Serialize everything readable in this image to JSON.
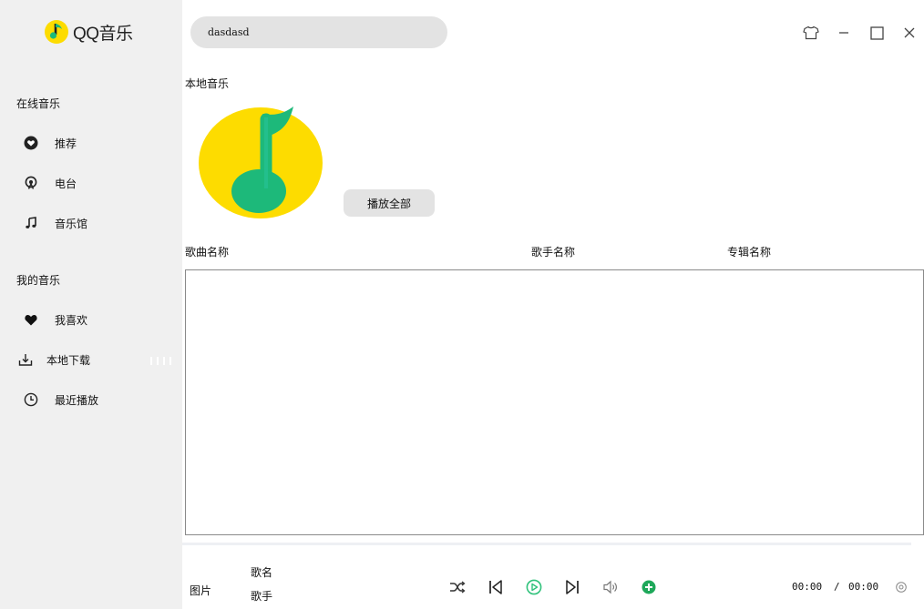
{
  "app": {
    "name": "QQ音乐"
  },
  "sidebar": {
    "online_title": "在线音乐",
    "online_items": [
      {
        "label": "推荐",
        "icon": "heart-circle-icon"
      },
      {
        "label": "电台",
        "icon": "radio-icon"
      },
      {
        "label": "音乐馆",
        "icon": "music-note-icon"
      }
    ],
    "mine_title": "我的音乐",
    "mine_items": [
      {
        "label": "我喜欢",
        "icon": "heart-icon"
      },
      {
        "label": "本地下载",
        "icon": "download-icon"
      },
      {
        "label": "最近播放",
        "icon": "clock-icon"
      }
    ]
  },
  "search": {
    "value": "dasdasd"
  },
  "window_controls": [
    "skin-icon",
    "minimize-icon",
    "maximize-icon",
    "close-icon"
  ],
  "local": {
    "title": "本地音乐",
    "play_all": "播放全部"
  },
  "table": {
    "columns": [
      "歌曲名称",
      "歌手名称",
      "专辑名称"
    ]
  },
  "player": {
    "picture_label": "图片",
    "song_label": "歌名",
    "singer_label": "歌手",
    "current_time": "00:00",
    "separator": "/",
    "total_time": "00:00",
    "controls": [
      "shuffle-icon",
      "previous-icon",
      "play-icon",
      "next-icon",
      "volume-icon",
      "add-icon"
    ]
  },
  "colors": {
    "accent_green": "#31c27c",
    "logo_yellow": "#fddc00",
    "sidebar_bg": "#f0f0f0",
    "main_bg": "#ffffff"
  }
}
